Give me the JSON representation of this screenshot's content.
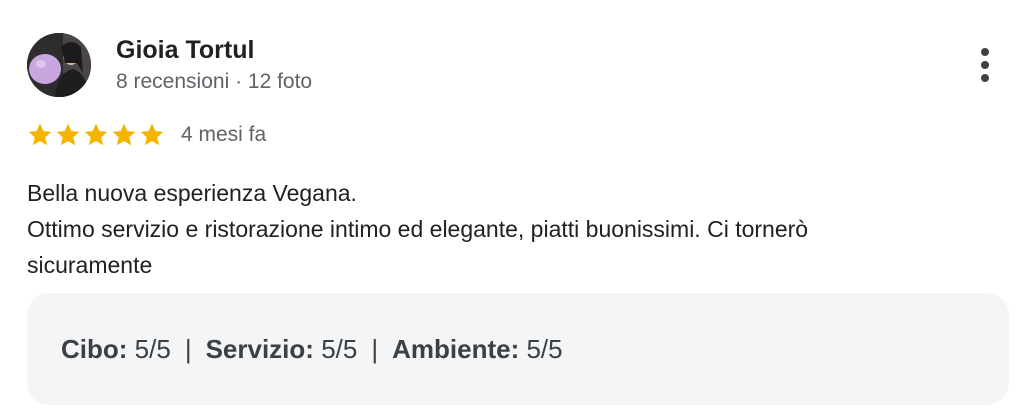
{
  "author": {
    "name": "Gioia Tortul",
    "meta": "8 recensioni · 12 foto",
    "avatar": "profile-photo-avatar"
  },
  "menu": {
    "icon": "more-vert-icon"
  },
  "rating": {
    "stars": 5,
    "max_stars": 5,
    "star_color": "#f4b400",
    "time": "4 mesi fa"
  },
  "review": {
    "lines": [
      "Bella nuova esperienza Vegana.",
      "Ottimo servizio e ristorazione intimo ed elegante, piatti buonissimi. Ci tornerò",
      "sicuramente"
    ]
  },
  "attributes": {
    "food": {
      "label": "Cibo:",
      "value": "5/5"
    },
    "service": {
      "label": "Servizio:",
      "value": "5/5"
    },
    "ambience": {
      "label": "Ambiente:",
      "value": "5/5"
    },
    "separator": "|"
  }
}
